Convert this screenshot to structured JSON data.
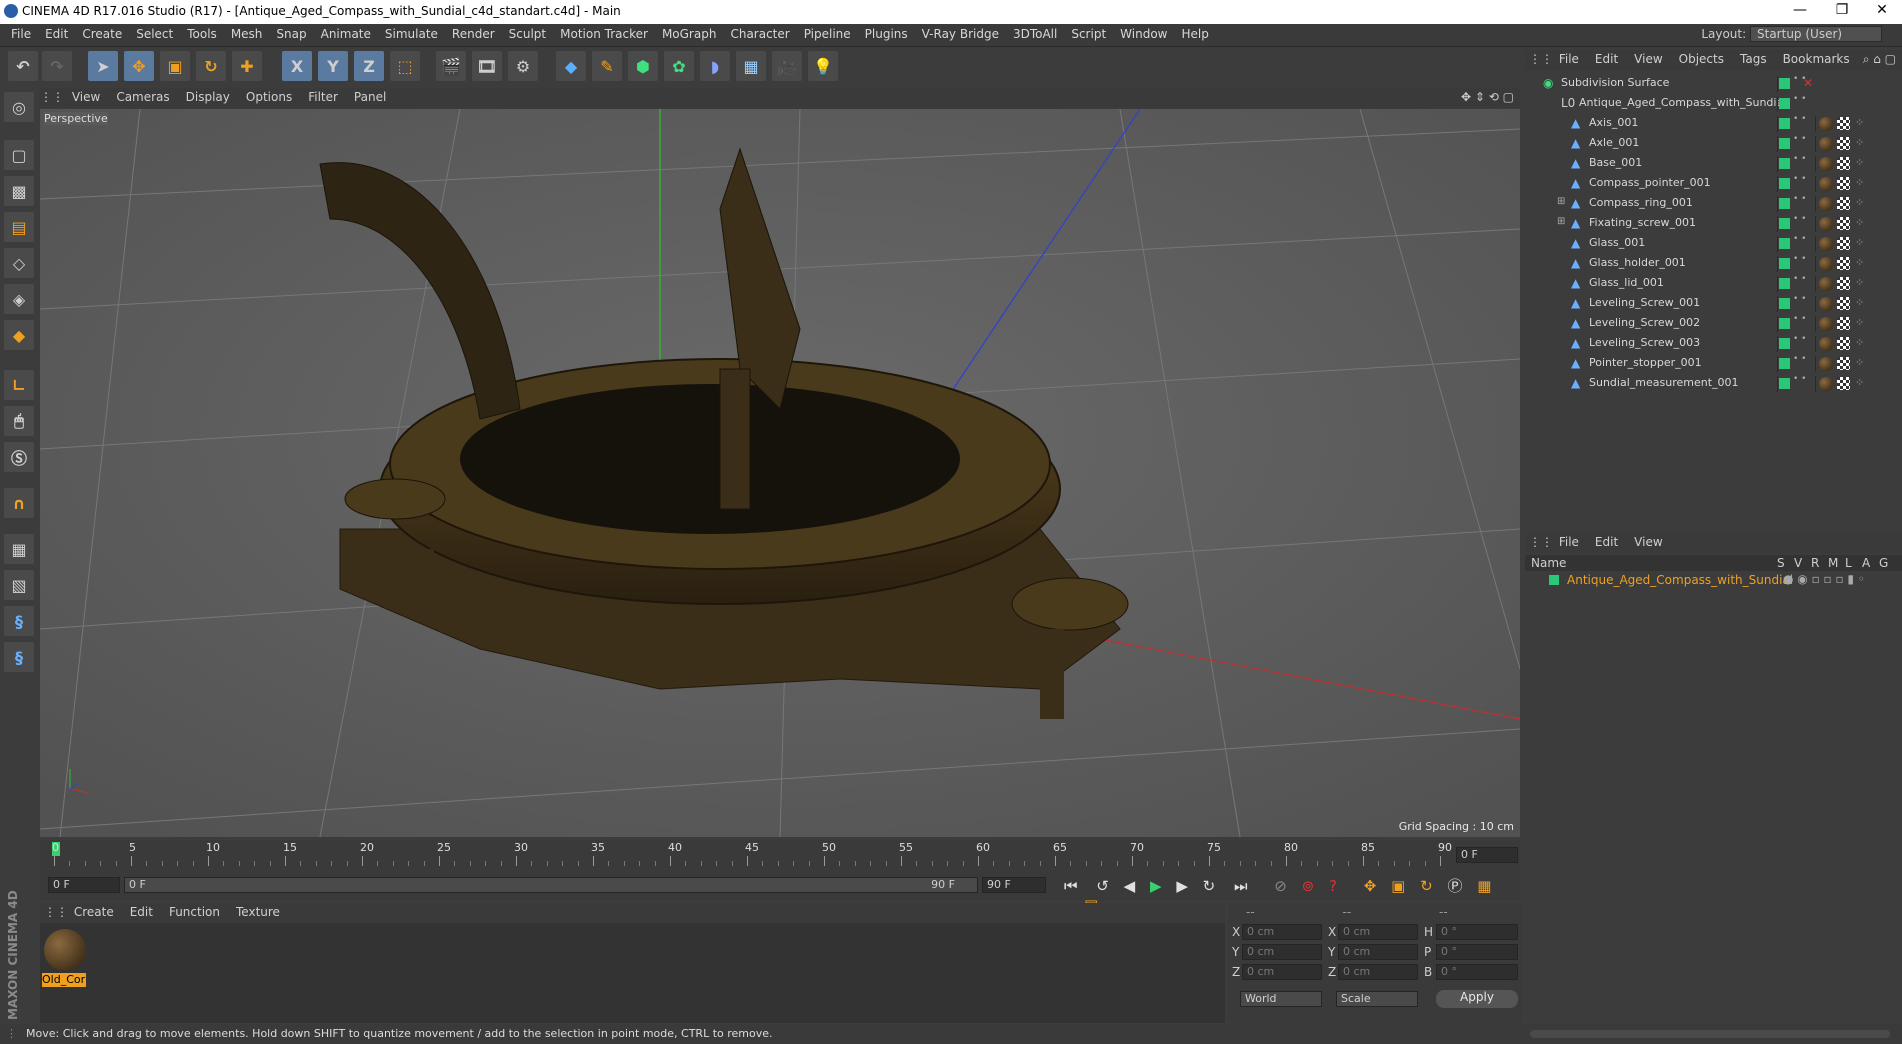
{
  "window": {
    "title": "CINEMA 4D R17.016 Studio (R17) - [Antique_Aged_Compass_with_Sundial_c4d_standart.c4d] - Main",
    "minimize": "—",
    "maximize": "❐",
    "close": "✕"
  },
  "menu": [
    "File",
    "Edit",
    "Create",
    "Select",
    "Tools",
    "Mesh",
    "Snap",
    "Animate",
    "Simulate",
    "Render",
    "Sculpt",
    "Motion Tracker",
    "MoGraph",
    "Character",
    "Pipeline",
    "Plugins",
    "V-Ray Bridge",
    "3DToAll",
    "Script",
    "Window",
    "Help"
  ],
  "layout": {
    "label": "Layout:",
    "value": "Startup (User)"
  },
  "toolbar": {
    "x": "X",
    "y": "Y",
    "z": "Z"
  },
  "viewport": {
    "menu": [
      "View",
      "Cameras",
      "Display",
      "Options",
      "Filter",
      "Panel"
    ],
    "label": "Perspective",
    "grid_spacing": "Grid Spacing : 10 cm"
  },
  "timeline": {
    "ticks": [
      "0",
      "5",
      "10",
      "15",
      "20",
      "25",
      "30",
      "35",
      "40",
      "45",
      "50",
      "55",
      "60",
      "65",
      "70",
      "75",
      "80",
      "85",
      "90"
    ],
    "end_frame": "0 F",
    "start": "0 F",
    "slider_start": "0 F",
    "slider_end": "90 F",
    "end": "90 F"
  },
  "material_manager": {
    "menu": [
      "Create",
      "Edit",
      "Function",
      "Texture"
    ],
    "material_name": "Old_Cor"
  },
  "coords": {
    "header": [
      "--",
      "--",
      "--"
    ],
    "rows": [
      {
        "a": "X",
        "av": "0 cm",
        "b": "X",
        "bv": "0 cm",
        "c": "H",
        "cv": "0 °"
      },
      {
        "a": "Y",
        "av": "0 cm",
        "b": "Y",
        "bv": "0 cm",
        "c": "P",
        "cv": "0 °"
      },
      {
        "a": "Z",
        "av": "0 cm",
        "b": "Z",
        "bv": "0 cm",
        "c": "B",
        "cv": "0 °"
      }
    ],
    "world": "World",
    "scale": "Scale",
    "apply": "Apply"
  },
  "object_manager": {
    "menu": [
      "File",
      "Edit",
      "View",
      "Objects",
      "Tags",
      "Bookmarks"
    ],
    "root": "Subdivision Surface",
    "group": "Antique_Aged_Compass_with_Sundial",
    "children": [
      "Axis_001",
      "Axle_001",
      "Base_001",
      "Compass_pointer_001",
      "Compass_ring_001",
      "Fixating_screw_001",
      "Glass_001",
      "Glass_holder_001",
      "Glass_lid_001",
      "Leveling_Screw_001",
      "Leveling_Screw_002",
      "Leveling_Screw_003",
      "Pointer_stopper_001",
      "Sundial_measurement_001"
    ]
  },
  "layer_manager": {
    "menu": [
      "File",
      "Edit",
      "View"
    ],
    "columns": {
      "name": "Name",
      "s": "S",
      "v": "V",
      "r": "R",
      "m": "M",
      "l": "L",
      "a": "A",
      "g": "G"
    },
    "layer_name": "Antique_Aged_Compass_with_Sundial"
  },
  "status": "Move: Click and drag to move elements. Hold down SHIFT to quantize movement / add to the selection in point mode, CTRL to remove.",
  "brand": "MAXON CINEMA 4D",
  "colors": {
    "accent_orange": "#f0a020",
    "layer_green": "#28c878",
    "viewport_bg": "#5e5e5e"
  }
}
